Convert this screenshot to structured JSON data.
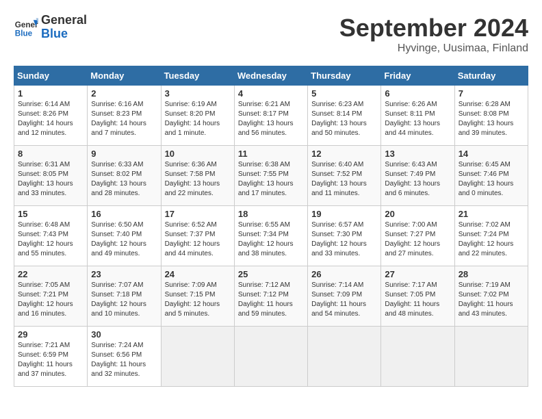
{
  "header": {
    "logo_line1": "General",
    "logo_line2": "Blue",
    "month_title": "September 2024",
    "location": "Hyvinge, Uusimaa, Finland"
  },
  "weekdays": [
    "Sunday",
    "Monday",
    "Tuesday",
    "Wednesday",
    "Thursday",
    "Friday",
    "Saturday"
  ],
  "rows": [
    [
      {
        "day": "1",
        "info": "Sunrise: 6:14 AM\nSunset: 8:26 PM\nDaylight: 14 hours\nand 12 minutes."
      },
      {
        "day": "2",
        "info": "Sunrise: 6:16 AM\nSunset: 8:23 PM\nDaylight: 14 hours\nand 7 minutes."
      },
      {
        "day": "3",
        "info": "Sunrise: 6:19 AM\nSunset: 8:20 PM\nDaylight: 14 hours\nand 1 minute."
      },
      {
        "day": "4",
        "info": "Sunrise: 6:21 AM\nSunset: 8:17 PM\nDaylight: 13 hours\nand 56 minutes."
      },
      {
        "day": "5",
        "info": "Sunrise: 6:23 AM\nSunset: 8:14 PM\nDaylight: 13 hours\nand 50 minutes."
      },
      {
        "day": "6",
        "info": "Sunrise: 6:26 AM\nSunset: 8:11 PM\nDaylight: 13 hours\nand 44 minutes."
      },
      {
        "day": "7",
        "info": "Sunrise: 6:28 AM\nSunset: 8:08 PM\nDaylight: 13 hours\nand 39 minutes."
      }
    ],
    [
      {
        "day": "8",
        "info": "Sunrise: 6:31 AM\nSunset: 8:05 PM\nDaylight: 13 hours\nand 33 minutes."
      },
      {
        "day": "9",
        "info": "Sunrise: 6:33 AM\nSunset: 8:02 PM\nDaylight: 13 hours\nand 28 minutes."
      },
      {
        "day": "10",
        "info": "Sunrise: 6:36 AM\nSunset: 7:58 PM\nDaylight: 13 hours\nand 22 minutes."
      },
      {
        "day": "11",
        "info": "Sunrise: 6:38 AM\nSunset: 7:55 PM\nDaylight: 13 hours\nand 17 minutes."
      },
      {
        "day": "12",
        "info": "Sunrise: 6:40 AM\nSunset: 7:52 PM\nDaylight: 13 hours\nand 11 minutes."
      },
      {
        "day": "13",
        "info": "Sunrise: 6:43 AM\nSunset: 7:49 PM\nDaylight: 13 hours\nand 6 minutes."
      },
      {
        "day": "14",
        "info": "Sunrise: 6:45 AM\nSunset: 7:46 PM\nDaylight: 13 hours\nand 0 minutes."
      }
    ],
    [
      {
        "day": "15",
        "info": "Sunrise: 6:48 AM\nSunset: 7:43 PM\nDaylight: 12 hours\nand 55 minutes."
      },
      {
        "day": "16",
        "info": "Sunrise: 6:50 AM\nSunset: 7:40 PM\nDaylight: 12 hours\nand 49 minutes."
      },
      {
        "day": "17",
        "info": "Sunrise: 6:52 AM\nSunset: 7:37 PM\nDaylight: 12 hours\nand 44 minutes."
      },
      {
        "day": "18",
        "info": "Sunrise: 6:55 AM\nSunset: 7:34 PM\nDaylight: 12 hours\nand 38 minutes."
      },
      {
        "day": "19",
        "info": "Sunrise: 6:57 AM\nSunset: 7:30 PM\nDaylight: 12 hours\nand 33 minutes."
      },
      {
        "day": "20",
        "info": "Sunrise: 7:00 AM\nSunset: 7:27 PM\nDaylight: 12 hours\nand 27 minutes."
      },
      {
        "day": "21",
        "info": "Sunrise: 7:02 AM\nSunset: 7:24 PM\nDaylight: 12 hours\nand 22 minutes."
      }
    ],
    [
      {
        "day": "22",
        "info": "Sunrise: 7:05 AM\nSunset: 7:21 PM\nDaylight: 12 hours\nand 16 minutes."
      },
      {
        "day": "23",
        "info": "Sunrise: 7:07 AM\nSunset: 7:18 PM\nDaylight: 12 hours\nand 10 minutes."
      },
      {
        "day": "24",
        "info": "Sunrise: 7:09 AM\nSunset: 7:15 PM\nDaylight: 12 hours\nand 5 minutes."
      },
      {
        "day": "25",
        "info": "Sunrise: 7:12 AM\nSunset: 7:12 PM\nDaylight: 11 hours\nand 59 minutes."
      },
      {
        "day": "26",
        "info": "Sunrise: 7:14 AM\nSunset: 7:09 PM\nDaylight: 11 hours\nand 54 minutes."
      },
      {
        "day": "27",
        "info": "Sunrise: 7:17 AM\nSunset: 7:05 PM\nDaylight: 11 hours\nand 48 minutes."
      },
      {
        "day": "28",
        "info": "Sunrise: 7:19 AM\nSunset: 7:02 PM\nDaylight: 11 hours\nand 43 minutes."
      }
    ],
    [
      {
        "day": "29",
        "info": "Sunrise: 7:21 AM\nSunset: 6:59 PM\nDaylight: 11 hours\nand 37 minutes."
      },
      {
        "day": "30",
        "info": "Sunrise: 7:24 AM\nSunset: 6:56 PM\nDaylight: 11 hours\nand 32 minutes."
      },
      null,
      null,
      null,
      null,
      null
    ]
  ]
}
